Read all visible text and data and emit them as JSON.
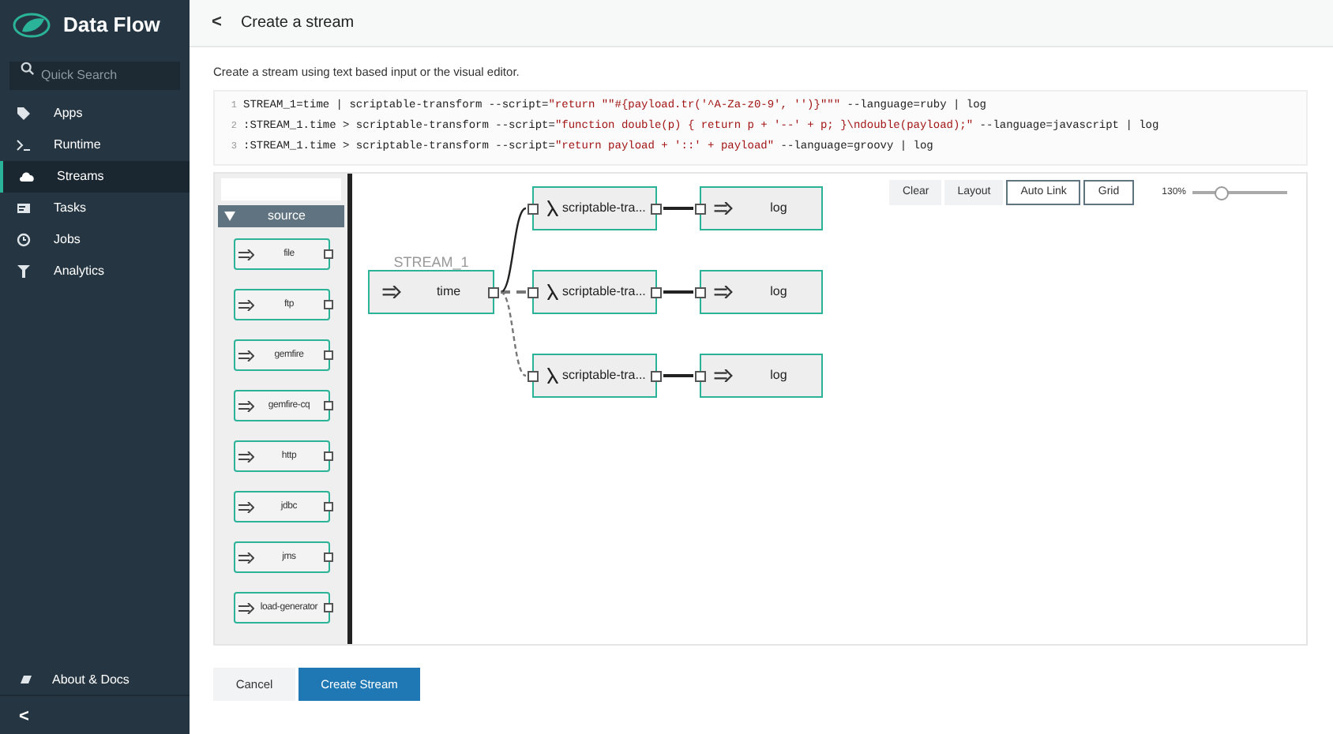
{
  "sidebar": {
    "brand": "Data Flow",
    "search": {
      "placeholder": "Quick Search"
    },
    "items": [
      {
        "label": "Apps",
        "selected": false
      },
      {
        "label": "Runtime",
        "selected": false
      },
      {
        "label": "Streams",
        "selected": true
      },
      {
        "label": "Tasks",
        "selected": false
      },
      {
        "label": "Jobs",
        "selected": false
      },
      {
        "label": "Analytics",
        "selected": false
      }
    ],
    "footer": {
      "label": "About & Docs"
    },
    "collapse": "<"
  },
  "header": {
    "back": "<",
    "title": "Create a stream"
  },
  "description": "Create a stream using text based input or the visual editor.",
  "editor": {
    "lines": [
      {
        "number": "1",
        "segments": [
          {
            "kind": "plain",
            "text": "STREAM_1=time | scriptable-transform --script="
          },
          {
            "kind": "string",
            "text": "\"return \"\"#{payload.tr('^A-Za-z0-9', '')}\"\"\""
          },
          {
            "kind": "plain",
            "text": " --language=ruby | log"
          }
        ]
      },
      {
        "number": "2",
        "segments": [
          {
            "kind": "plain",
            "text": ":STREAM_1.time > scriptable-transform --script="
          },
          {
            "kind": "string",
            "text": "\"function double(p) { return p + '--' + p; }\\ndouble(payload);\""
          },
          {
            "kind": "plain",
            "text": " --language=javascript | log"
          }
        ]
      },
      {
        "number": "3",
        "segments": [
          {
            "kind": "plain",
            "text": ":STREAM_1.time > scriptable-transform --script="
          },
          {
            "kind": "string",
            "text": "\"return payload + '::' + payload\""
          },
          {
            "kind": "plain",
            "text": " --language=groovy | log"
          }
        ]
      }
    ]
  },
  "palette": {
    "group": {
      "label": "source",
      "expanded": true
    },
    "items": [
      "file",
      "ftp",
      "gemfire",
      "gemfire-cq",
      "http",
      "jdbc",
      "jms",
      "load-generator"
    ]
  },
  "toolbar": {
    "buttons": [
      {
        "label": "Clear",
        "kind": "action"
      },
      {
        "label": "Layout",
        "kind": "action"
      },
      {
        "label": "Auto Link",
        "kind": "toggle"
      },
      {
        "label": "Grid",
        "kind": "toggle"
      }
    ],
    "zoom": {
      "reading": "130%",
      "level": 0.3
    }
  },
  "graph": {
    "stream_label": "STREAM_1",
    "source": {
      "label": "time"
    },
    "branches": [
      {
        "tapped": false,
        "processor": "scriptable-tra...",
        "sink": "log"
      },
      {
        "tapped": true,
        "processor": "scriptable-tra...",
        "sink": "log"
      },
      {
        "tapped": true,
        "processor": "scriptable-tra...",
        "sink": "log"
      }
    ]
  },
  "actions": [
    {
      "label": "Cancel",
      "kind": "secondary"
    },
    {
      "label": "Create Stream",
      "kind": "primary"
    }
  ]
}
